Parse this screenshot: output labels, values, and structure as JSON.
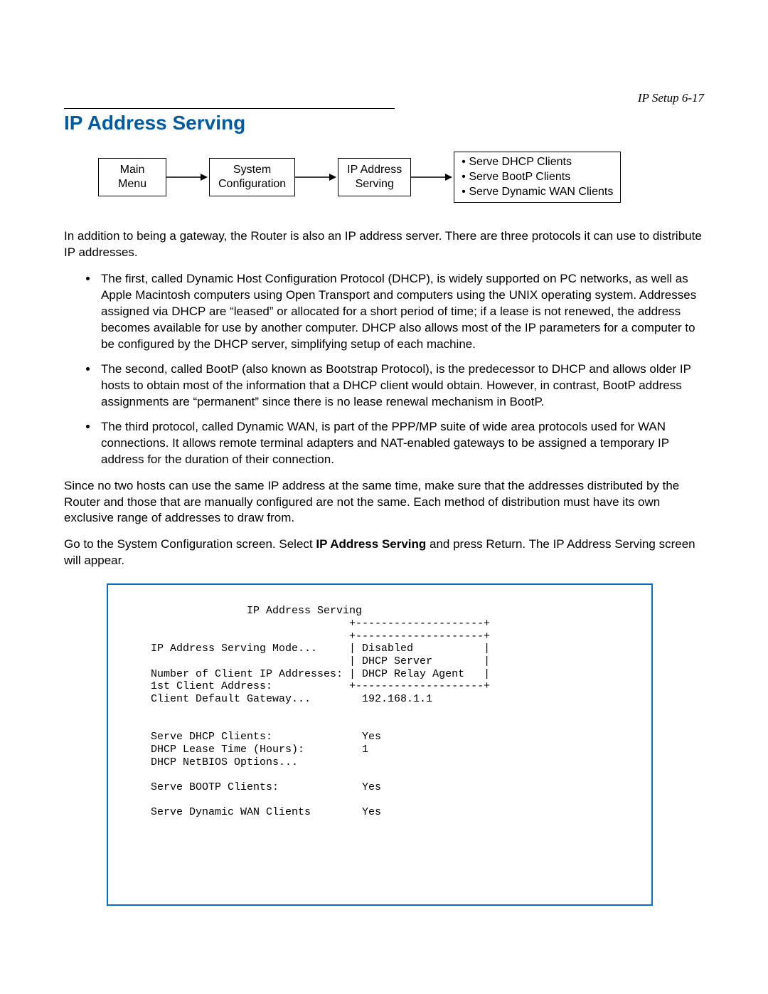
{
  "header": {
    "running": "IP Setup   6-17",
    "title": "IP Address Serving"
  },
  "nav": {
    "box1_line1": "Main",
    "box1_line2": "Menu",
    "box2_line1": "System",
    "box2_line2": "Configuration",
    "box3_line1": "IP Address",
    "box3_line2": "Serving",
    "detail1": "Serve DHCP Clients",
    "detail2": "Serve BootP Clients",
    "detail3": "Serve Dynamic WAN Clients"
  },
  "para1": "In addition to being a gateway, the Router is also an IP address server. There are three protocols it can use to distribute IP addresses.",
  "bullet1": "The first, called Dynamic Host Configuration Protocol (DHCP), is widely supported on PC networks, as well as Apple Macintosh computers using Open Transport and computers using the UNIX operating system. Addresses assigned via DHCP are “leased” or allocated for a short period of time; if a lease is not renewed, the address becomes available for use by another computer. DHCP also allows most of the IP parameters for a computer to be configured by the DHCP server, simplifying setup of each machine.",
  "bullet2": "The second, called BootP (also known as Bootstrap Protocol), is the predecessor to DHCP and allows older IP hosts to obtain most of the information that a DHCP client would obtain. However, in contrast, BootP address assignments are “permanent” since there is no lease renewal mechanism in BootP.",
  "bullet3": "The third protocol, called Dynamic WAN, is part of the PPP/MP suite of wide area protocols used for WAN connections. It allows remote terminal adapters and NAT-enabled gateways to be assigned a temporary IP address for the duration of their connection.",
  "para2": "Since no two hosts can use the same IP address at the same time, make sure that the addresses distributed by the Router and those that are manually configured are not the same. Each method of distribution must have its own exclusive range of addresses to draw from.",
  "para3_pre": "Go to the System Configuration screen. Select ",
  "para3_bold": "IP Address Serving",
  "para3_post": " and press Return. The IP Address Serving screen will appear.",
  "terminal": "               IP Address Serving\n                               +--------------------+\n                               +--------------------+\nIP Address Serving Mode...     | Disabled           |\n                               | DHCP Server        |\nNumber of Client IP Addresses: | DHCP Relay Agent   |\n1st Client Address:            +--------------------+\nClient Default Gateway...        192.168.1.1\n\n\nServe DHCP Clients:              Yes\nDHCP Lease Time (Hours):         1\nDHCP NetBIOS Options...\n\nServe BOOTP Clients:             Yes\n\nServe Dynamic WAN Clients        Yes"
}
